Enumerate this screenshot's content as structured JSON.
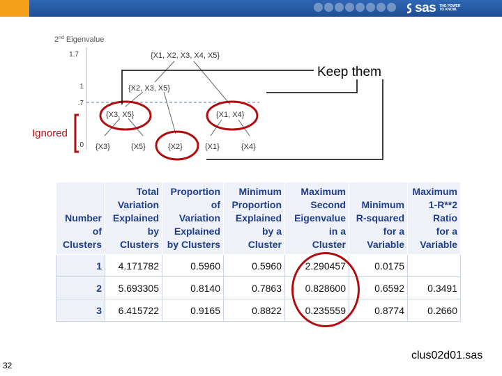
{
  "header": {
    "logo_text": "sas",
    "tagline": "THE POWER TO KNOW."
  },
  "diagram": {
    "axis_title_prefix": "2",
    "axis_title_sup": "nd",
    "axis_title_word": "Eigenvalue",
    "ticks": [
      "1.7",
      "1",
      ".7",
      "0"
    ],
    "nodes": {
      "root": "{X1, X2, X3, X4, X5}",
      "left": "{X2, X3, X5}",
      "right": "{X1, X4}",
      "ll": "{X3, X5}",
      "l_leaf": "{X3}",
      "l_leaf2": "{X5}",
      "l_leaf3": "{X2}",
      "r_leaf1": "{X1}",
      "r_leaf2": "{X4}"
    },
    "keep_label": "Keep them",
    "ignored_label": "Ignored"
  },
  "table": {
    "headers": [
      "Number of Clusters",
      "Total Variation Explained by Clusters",
      "Proportion of Variation Explained by Clusters",
      "Minimum Proportion Explained by a Cluster",
      "Maximum Second Eigenvalue in a Cluster",
      "Minimum R-squared for a Variable",
      "Maximum 1-R**2 Ratio for a Variable"
    ],
    "header_lines": [
      [
        "Number",
        "of",
        "Clusters"
      ],
      [
        "Total",
        "Variation",
        "Explained",
        "by",
        "Clusters"
      ],
      [
        "Proportion",
        "of",
        "Variation",
        "Explained",
        "by Clusters"
      ],
      [
        "Minimum",
        "Proportion",
        "Explained",
        "by a",
        "Cluster"
      ],
      [
        "Maximum",
        "Second",
        "Eigenvalue",
        "in a",
        "Cluster"
      ],
      [
        "Minimum",
        "R-squared",
        "for a",
        "Variable"
      ],
      [
        "Maximum",
        "1-R**2",
        "Ratio",
        "for a",
        "Variable"
      ]
    ],
    "rows": [
      [
        "1",
        "4.171782",
        "0.5960",
        "0.5960",
        "2.290457",
        "0.0175",
        ""
      ],
      [
        "2",
        "5.693305",
        "0.8140",
        "0.7863",
        "0.828600",
        "0.6592",
        "0.3491"
      ],
      [
        "3",
        "6.415722",
        "0.9165",
        "0.8822",
        "0.235559",
        "0.8774",
        "0.2660"
      ]
    ]
  },
  "footer": {
    "page_number": "32",
    "filename": "clus02d01.sas"
  },
  "colors": {
    "sas_blue": "#1e4f96",
    "sas_orange": "#f5a01a",
    "highlight_red": "#b10d10",
    "header_text_blue": "#1f3e8c",
    "header_bg": "#eef1f8"
  }
}
